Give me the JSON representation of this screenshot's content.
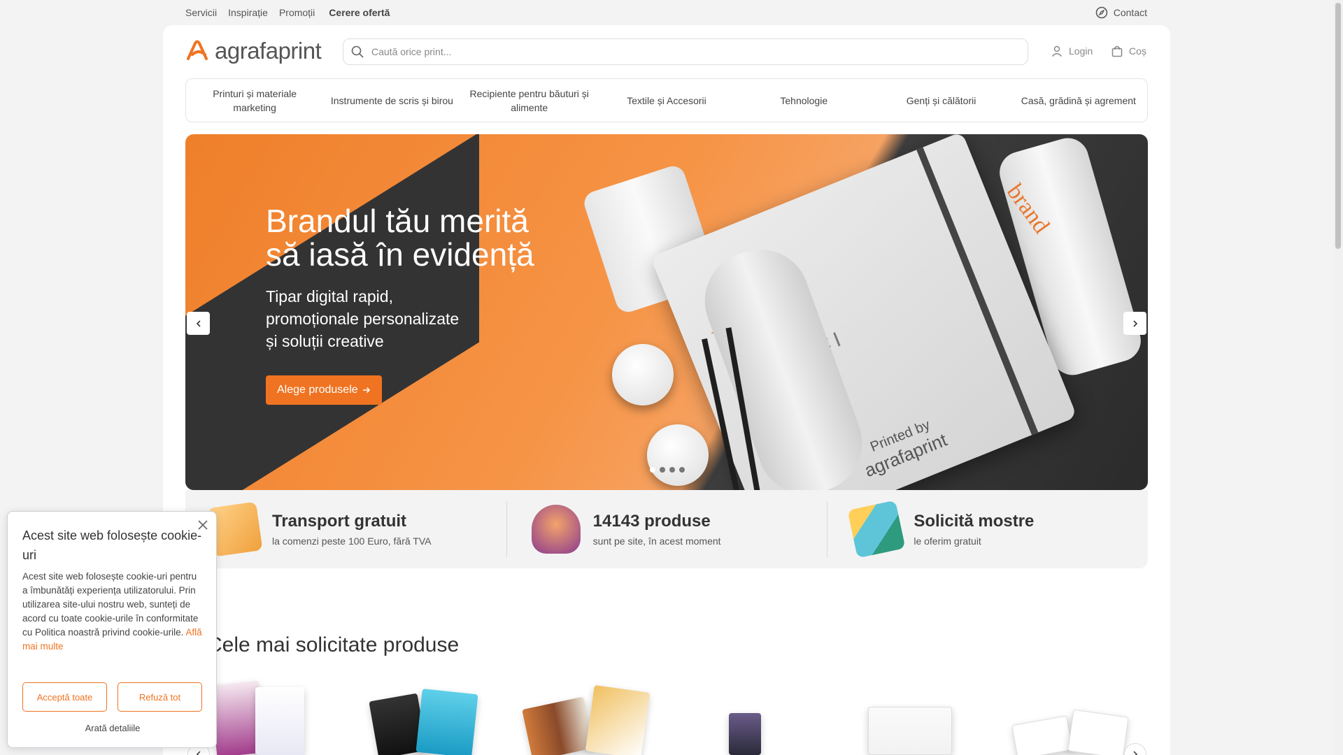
{
  "topnav": {
    "items": [
      "Servicii",
      "Inspirație",
      "Promoții"
    ],
    "quote": "Cerere ofertă",
    "contact": "Contact"
  },
  "header": {
    "logo": "agrafaprint",
    "search_placeholder": "Caută orice print...",
    "login": "Login",
    "cart": "Coș"
  },
  "categories": [
    "Printuri și materiale marketing",
    "Instrumente de scris și birou",
    "Recipiente pentru băuturi și alimente",
    "Textile și Accesorii",
    "Tehnologie",
    "Genți și călătorii",
    "Casă, grădină și agrement"
  ],
  "hero": {
    "title_line1": "Brandul tău merită",
    "title_line2": "să iasă în evidență",
    "sub_line1": "Tipar digital rapid,",
    "sub_line2": "promoționale personalizate",
    "sub_line3": "și soluții creative",
    "cta": "Alege produsele",
    "slides": 4,
    "active_slide": 1,
    "mock_brand": "brand",
    "mock_ul": "ul",
    "mock_tagline": "TĂU AICI",
    "mock_printed_by": "Printed by",
    "mock_logo": "agrafaprint"
  },
  "benefits": [
    {
      "title": "Transport gratuit",
      "sub": "la comenzi peste 100 Euro, fără TVA"
    },
    {
      "title": "14143 produse",
      "sub": "sunt pe site, în acest moment"
    },
    {
      "title": "Solicită mostre",
      "sub": "le oferim gratuit"
    }
  ],
  "section": {
    "title": "Cele mai solicitate produse"
  },
  "cookie": {
    "title": "Acest site web folosește cookie-uri",
    "body": "Acest site web folosește cookie-uri pentru a îmbunătăți experiența utilizatorului. Prin utilizarea site-ului nostru web, sunteți de acord cu toate cookie-urile în conformitate cu Politica noastră privind cookie-urile.",
    "link": "Află mai multe",
    "accept": "Acceptă toate",
    "reject": "Refuză tot",
    "details": "Arată detaliile"
  },
  "colors": {
    "accent": "#ef7321",
    "text": "#333333",
    "muted": "#888888"
  }
}
